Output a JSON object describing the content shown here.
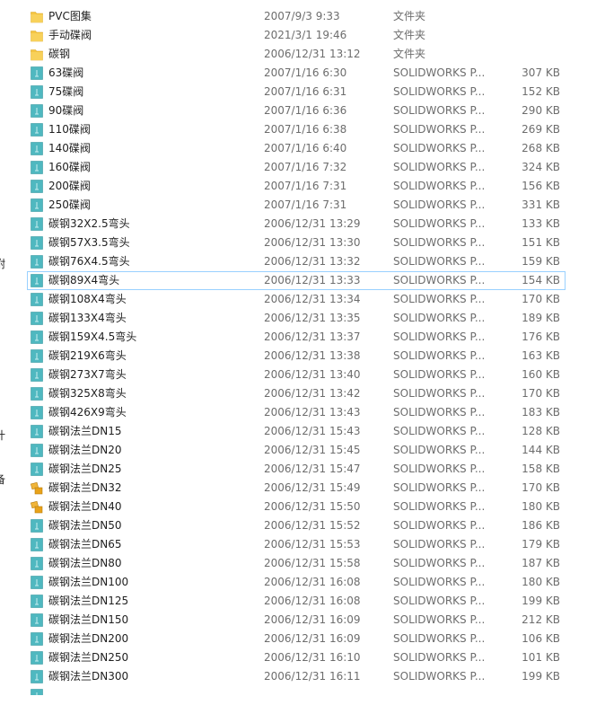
{
  "colors": {
    "folder": "#f5c542",
    "part_icon": "#4fb8c0",
    "asm_icon": "#e8a21a",
    "selection_border": "#99d1ff",
    "meta_text": "#6d6d6d"
  },
  "left_fragments": [
    {
      "text": "附"
    },
    {
      "text": "计"
    },
    {
      "text": "备"
    }
  ],
  "files": [
    {
      "name": "PVC图集",
      "date": "2007/9/3 9:33",
      "type": "文件夹",
      "size": "",
      "icon": "folder-icon"
    },
    {
      "name": "手动碟阀",
      "date": "2021/3/1 19:46",
      "type": "文件夹",
      "size": "",
      "icon": "folder-icon"
    },
    {
      "name": "碳钢",
      "date": "2006/12/31 13:12",
      "type": "文件夹",
      "size": "",
      "icon": "folder-icon"
    },
    {
      "name": "63碟阀",
      "date": "2007/1/16 6:30",
      "type": "SOLIDWORKS P...",
      "size": "307 KB",
      "icon": "solidworks-part-icon"
    },
    {
      "name": "75碟阀",
      "date": "2007/1/16 6:31",
      "type": "SOLIDWORKS P...",
      "size": "152 KB",
      "icon": "solidworks-part-icon"
    },
    {
      "name": "90碟阀",
      "date": "2007/1/16 6:36",
      "type": "SOLIDWORKS P...",
      "size": "290 KB",
      "icon": "solidworks-part-icon"
    },
    {
      "name": "110碟阀",
      "date": "2007/1/16 6:38",
      "type": "SOLIDWORKS P...",
      "size": "269 KB",
      "icon": "solidworks-part-icon"
    },
    {
      "name": "140碟阀",
      "date": "2007/1/16 6:40",
      "type": "SOLIDWORKS P...",
      "size": "268 KB",
      "icon": "solidworks-part-icon"
    },
    {
      "name": "160碟阀",
      "date": "2007/1/16 7:32",
      "type": "SOLIDWORKS P...",
      "size": "324 KB",
      "icon": "solidworks-part-icon"
    },
    {
      "name": "200碟阀",
      "date": "2007/1/16 7:31",
      "type": "SOLIDWORKS P...",
      "size": "156 KB",
      "icon": "solidworks-part-icon"
    },
    {
      "name": "250碟阀",
      "date": "2007/1/16 7:31",
      "type": "SOLIDWORKS P...",
      "size": "331 KB",
      "icon": "solidworks-part-icon"
    },
    {
      "name": "碳钢32X2.5弯头",
      "date": "2006/12/31 13:29",
      "type": "SOLIDWORKS P...",
      "size": "133 KB",
      "icon": "solidworks-part-icon"
    },
    {
      "name": "碳钢57X3.5弯头",
      "date": "2006/12/31 13:30",
      "type": "SOLIDWORKS P...",
      "size": "151 KB",
      "icon": "solidworks-part-icon"
    },
    {
      "name": "碳钢76X4.5弯头",
      "date": "2006/12/31 13:32",
      "type": "SOLIDWORKS P...",
      "size": "159 KB",
      "icon": "solidworks-part-icon"
    },
    {
      "name": "碳钢89X4弯头",
      "date": "2006/12/31 13:33",
      "type": "SOLIDWORKS P...",
      "size": "154 KB",
      "icon": "solidworks-part-icon",
      "selected": true
    },
    {
      "name": "碳钢108X4弯头",
      "date": "2006/12/31 13:34",
      "type": "SOLIDWORKS P...",
      "size": "170 KB",
      "icon": "solidworks-part-icon"
    },
    {
      "name": "碳钢133X4弯头",
      "date": "2006/12/31 13:35",
      "type": "SOLIDWORKS P...",
      "size": "189 KB",
      "icon": "solidworks-part-icon"
    },
    {
      "name": "碳钢159X4.5弯头",
      "date": "2006/12/31 13:37",
      "type": "SOLIDWORKS P...",
      "size": "176 KB",
      "icon": "solidworks-part-icon"
    },
    {
      "name": "碳钢219X6弯头",
      "date": "2006/12/31 13:38",
      "type": "SOLIDWORKS P...",
      "size": "163 KB",
      "icon": "solidworks-part-icon"
    },
    {
      "name": "碳钢273X7弯头",
      "date": "2006/12/31 13:40",
      "type": "SOLIDWORKS P...",
      "size": "160 KB",
      "icon": "solidworks-part-icon"
    },
    {
      "name": "碳钢325X8弯头",
      "date": "2006/12/31 13:42",
      "type": "SOLIDWORKS P...",
      "size": "170 KB",
      "icon": "solidworks-part-icon"
    },
    {
      "name": "碳钢426X9弯头",
      "date": "2006/12/31 13:43",
      "type": "SOLIDWORKS P...",
      "size": "183 KB",
      "icon": "solidworks-part-icon"
    },
    {
      "name": "碳钢法兰DN15",
      "date": "2006/12/31 15:43",
      "type": "SOLIDWORKS P...",
      "size": "128 KB",
      "icon": "solidworks-part-icon"
    },
    {
      "name": "碳钢法兰DN20",
      "date": "2006/12/31 15:45",
      "type": "SOLIDWORKS P...",
      "size": "144 KB",
      "icon": "solidworks-part-icon"
    },
    {
      "name": "碳钢法兰DN25",
      "date": "2006/12/31 15:47",
      "type": "SOLIDWORKS P...",
      "size": "158 KB",
      "icon": "solidworks-part-icon"
    },
    {
      "name": "碳钢法兰DN32",
      "date": "2006/12/31 15:49",
      "type": "SOLIDWORKS P...",
      "size": "170 KB",
      "icon": "solidworks-assembly-icon"
    },
    {
      "name": "碳钢法兰DN40",
      "date": "2006/12/31 15:50",
      "type": "SOLIDWORKS P...",
      "size": "180 KB",
      "icon": "solidworks-assembly-icon"
    },
    {
      "name": "碳钢法兰DN50",
      "date": "2006/12/31 15:52",
      "type": "SOLIDWORKS P...",
      "size": "186 KB",
      "icon": "solidworks-part-icon"
    },
    {
      "name": "碳钢法兰DN65",
      "date": "2006/12/31 15:53",
      "type": "SOLIDWORKS P...",
      "size": "179 KB",
      "icon": "solidworks-part-icon"
    },
    {
      "name": "碳钢法兰DN80",
      "date": "2006/12/31 15:58",
      "type": "SOLIDWORKS P...",
      "size": "187 KB",
      "icon": "solidworks-part-icon"
    },
    {
      "name": "碳钢法兰DN100",
      "date": "2006/12/31 16:08",
      "type": "SOLIDWORKS P...",
      "size": "180 KB",
      "icon": "solidworks-part-icon"
    },
    {
      "name": "碳钢法兰DN125",
      "date": "2006/12/31 16:08",
      "type": "SOLIDWORKS P...",
      "size": "199 KB",
      "icon": "solidworks-part-icon"
    },
    {
      "name": "碳钢法兰DN150",
      "date": "2006/12/31 16:09",
      "type": "SOLIDWORKS P...",
      "size": "212 KB",
      "icon": "solidworks-part-icon"
    },
    {
      "name": "碳钢法兰DN200",
      "date": "2006/12/31 16:09",
      "type": "SOLIDWORKS P...",
      "size": "106 KB",
      "icon": "solidworks-part-icon"
    },
    {
      "name": "碳钢法兰DN250",
      "date": "2006/12/31 16:10",
      "type": "SOLIDWORKS P...",
      "size": "101 KB",
      "icon": "solidworks-part-icon"
    },
    {
      "name": "碳钢法兰DN300",
      "date": "2006/12/31 16:11",
      "type": "SOLIDWORKS P...",
      "size": "199 KB",
      "icon": "solidworks-part-icon"
    }
  ]
}
